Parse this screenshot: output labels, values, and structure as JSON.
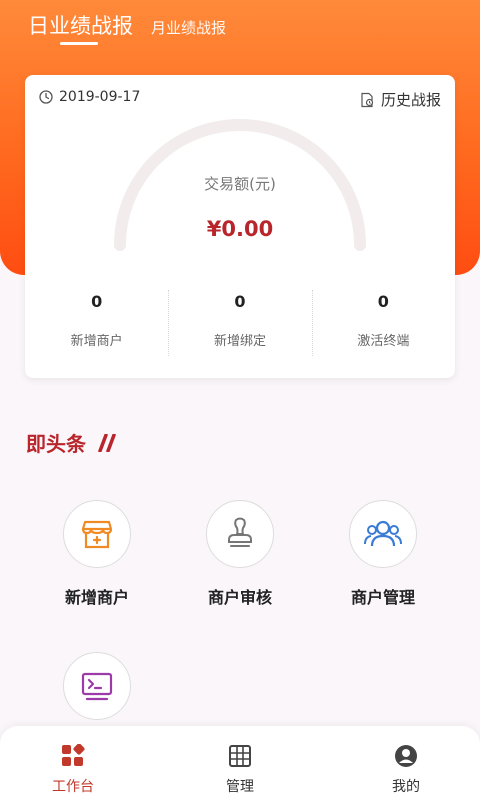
{
  "header": {
    "tabs": [
      {
        "label": "日业绩战报",
        "active": true
      },
      {
        "label": "月业绩战报",
        "active": false
      }
    ]
  },
  "summary_card": {
    "date": "2019-09-17",
    "history_label": "历史战报",
    "amount_label": "交易额(元)",
    "amount_value": "¥0.00",
    "stats": [
      {
        "value": "0",
        "label": "新增商户"
      },
      {
        "value": "0",
        "label": "新增绑定"
      },
      {
        "value": "0",
        "label": "激活终端"
      }
    ]
  },
  "section": {
    "title": "即头条"
  },
  "quick_actions": [
    {
      "label": "新增商户",
      "icon": "store-add-icon",
      "color": "#f08a24"
    },
    {
      "label": "商户审核",
      "icon": "stamp-icon",
      "color": "#777777"
    },
    {
      "label": "商户管理",
      "icon": "users-icon",
      "color": "#3a7bd5"
    },
    {
      "label": "",
      "icon": "terminal-icon",
      "color": "#9b3aa8"
    }
  ],
  "bottom_nav": [
    {
      "label": "工作台",
      "icon": "workbench-icon",
      "active": true
    },
    {
      "label": "管理",
      "icon": "grid-icon",
      "active": false
    },
    {
      "label": "我的",
      "icon": "profile-icon",
      "active": false
    }
  ],
  "colors": {
    "accent": "#b8262c",
    "header_gradient_top": "#ff8a3a",
    "header_gradient_bottom": "#ff4d12"
  }
}
